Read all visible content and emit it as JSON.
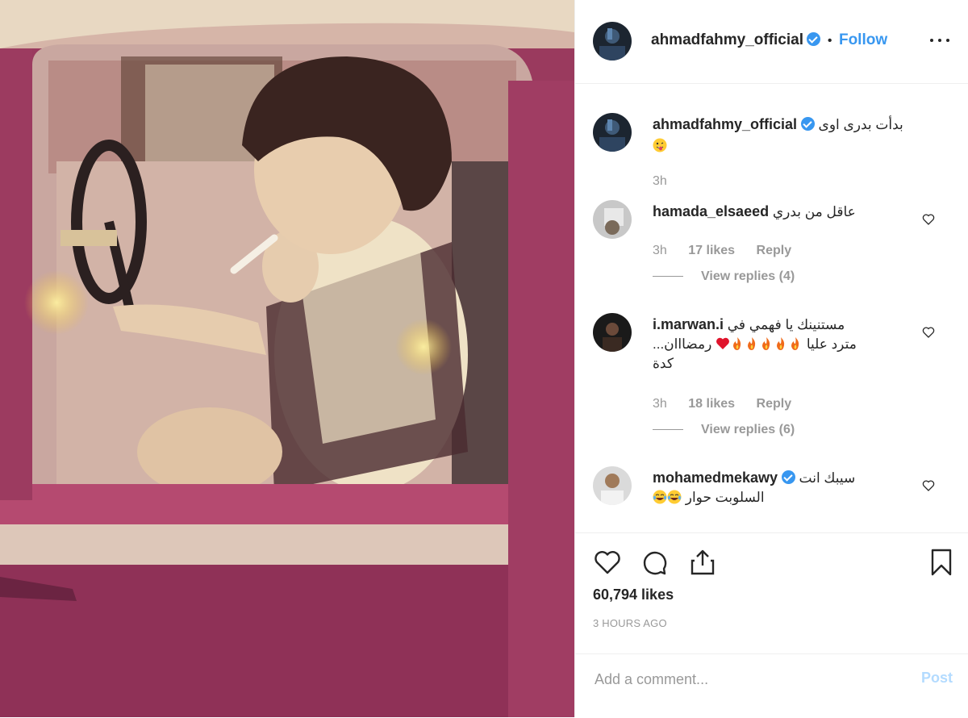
{
  "post": {
    "author": "ahmadfahmy_official",
    "follow_label": "Follow",
    "caption": "بدأت بدرى اوى",
    "caption_emoji": "stuck-out-tongue-winking-eye-icon",
    "caption_time": "3h",
    "likes": "60,794 likes",
    "posted_ago": "3 HOURS AGO"
  },
  "comments": [
    {
      "user": "hamada_elsaeed",
      "verified": false,
      "text": "عاقل من بدري",
      "time": "3h",
      "likes": "17 likes",
      "reply": "Reply",
      "view_replies": "View replies (4)"
    },
    {
      "user": "i.marwan.i",
      "verified": false,
      "text_line1": "مستنينك يا فهمي في",
      "text_line2": "رمضااان",
      "text_line2b": "...مترد عليا",
      "text_line3": "كدة",
      "emojis": [
        "red-heart-icon",
        "fire-icon",
        "fire-icon",
        "fire-icon",
        "fire-icon",
        "fire-icon"
      ],
      "time": "3h",
      "likes": "18 likes",
      "reply": "Reply",
      "view_replies": "View replies (6)"
    },
    {
      "user": "mohamedmekawy",
      "verified": true,
      "text_line1": "سيبك انت",
      "text_line2": "السلوبت حوار",
      "emojis": [
        "tears-of-joy-icon",
        "tears-of-joy-icon"
      ]
    }
  ],
  "add_comment": {
    "placeholder": "Add a comment...",
    "post_label": "Post"
  },
  "colors": {
    "accent": "#3897f0",
    "muted": "#999999",
    "post_disabled": "#b3dbff"
  }
}
